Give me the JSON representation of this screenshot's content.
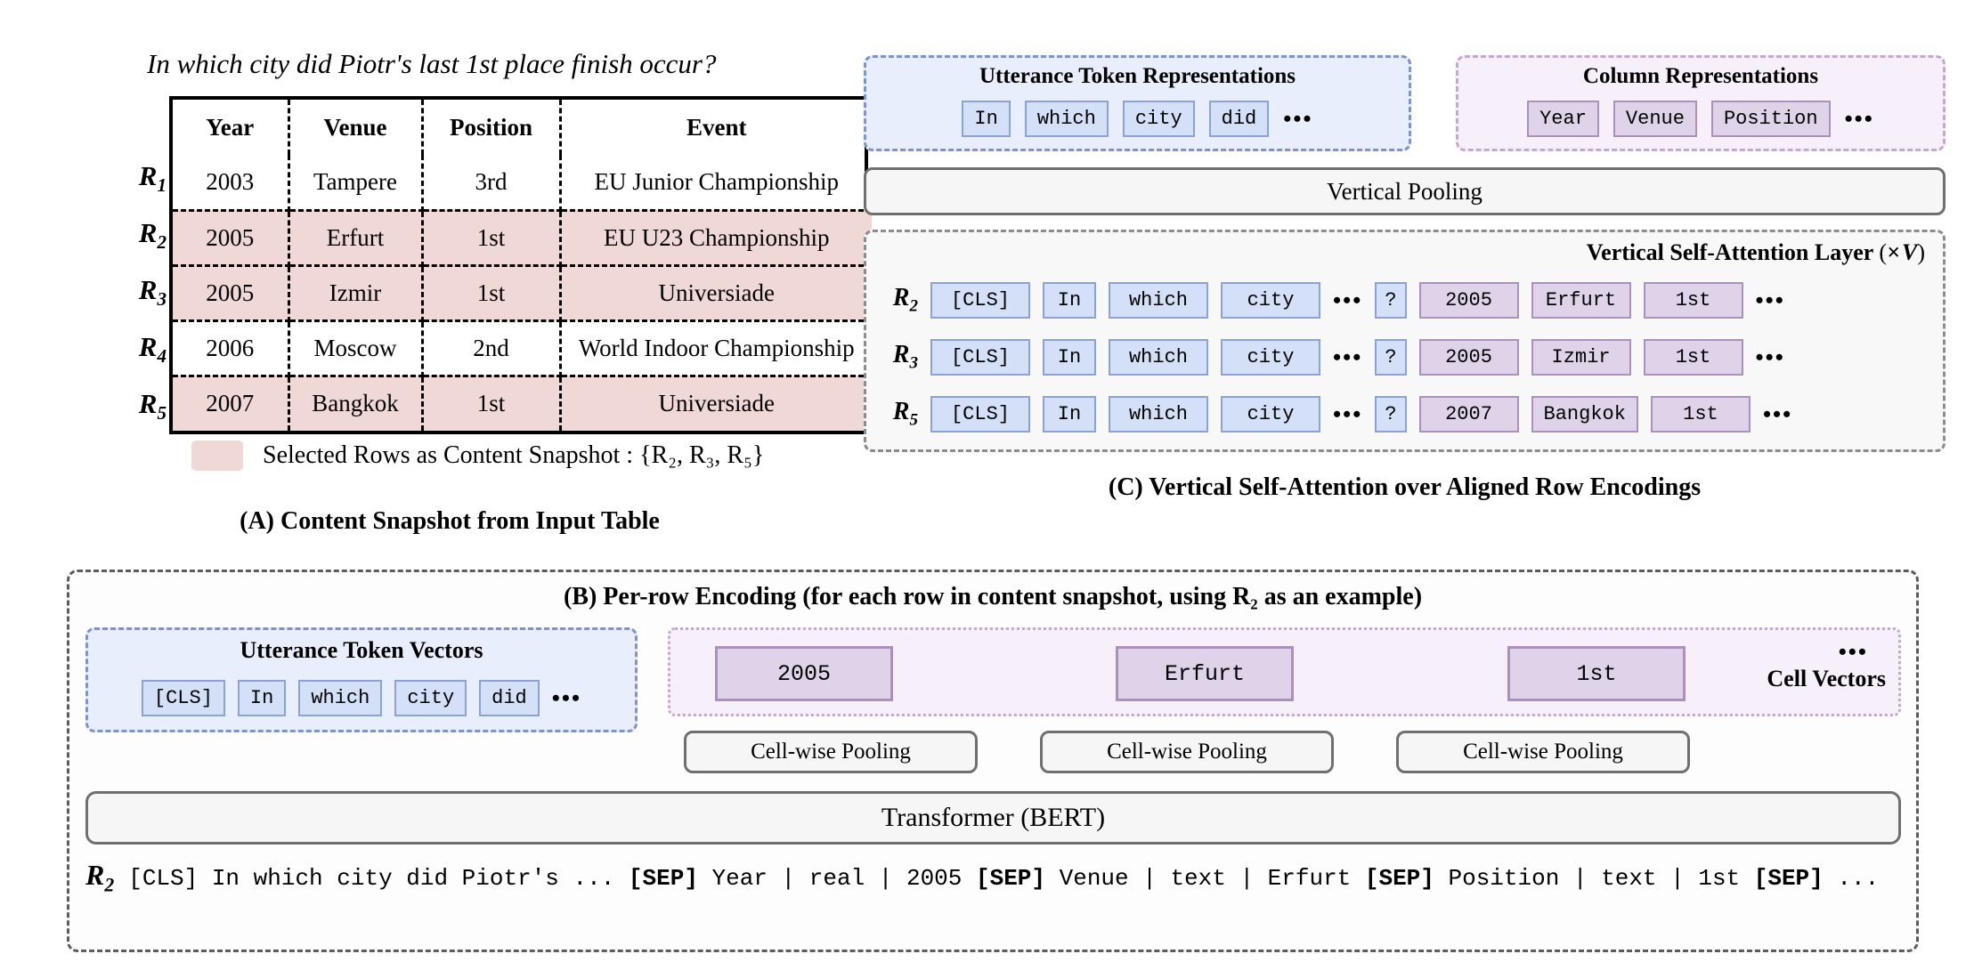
{
  "question": "In which city did Piotr's last 1st place finish occur?",
  "table": {
    "headers": [
      "Year",
      "Venue",
      "Position",
      "Event"
    ],
    "row_labels": [
      "R",
      "R",
      "R",
      "R",
      "R"
    ],
    "row_label_subs": [
      "1",
      "2",
      "3",
      "4",
      "5"
    ],
    "rows": [
      {
        "label_sub": "1",
        "selected": false,
        "cells": [
          "2003",
          "Tampere",
          "3rd",
          "EU Junior Championship"
        ]
      },
      {
        "label_sub": "2",
        "selected": true,
        "cells": [
          "2005",
          "Erfurt",
          "1st",
          "EU U23 Championship"
        ]
      },
      {
        "label_sub": "3",
        "selected": true,
        "cells": [
          "2005",
          "Izmir",
          "1st",
          "Universiade"
        ]
      },
      {
        "label_sub": "4",
        "selected": false,
        "cells": [
          "2006",
          "Moscow",
          "2nd",
          "World Indoor Championship"
        ]
      },
      {
        "label_sub": "5",
        "selected": true,
        "cells": [
          "2007",
          "Bangkok",
          "1st",
          "Universiade"
        ]
      }
    ]
  },
  "legend": {
    "text": "Selected Rows as Content Snapshot : {R₂, R₃, R₅}",
    "swatch_color": "#f0d8d6"
  },
  "captions": {
    "a": "(A) Content Snapshot from Input Table",
    "b": "(B) Per-row Encoding (for each row in content snapshot, using R₂ as an example)",
    "c": "(C) Vertical Self-Attention over Aligned Row Encodings"
  },
  "panel_c": {
    "utterance_box": {
      "title": "Utterance Token Representations",
      "tokens": [
        "In",
        "which",
        "city",
        "did"
      ],
      "ellipsis": "•••"
    },
    "column_box": {
      "title": "Column Representations",
      "tokens": [
        "Year",
        "Venue",
        "Position"
      ],
      "ellipsis": "•••"
    },
    "vertical_pooling_label": "Vertical Pooling",
    "vsa_title": "Vertical Self-Attention Layer",
    "vsa_multiplier": "(× V)",
    "rows": [
      {
        "label_sub": "2",
        "utterance_tokens": [
          "[CLS]",
          "In",
          "which",
          "city"
        ],
        "mid_ellipsis": "•••",
        "question_token": "?",
        "cell_tokens": [
          "2005",
          "Erfurt",
          "1st"
        ],
        "end_ellipsis": "•••"
      },
      {
        "label_sub": "3",
        "utterance_tokens": [
          "[CLS]",
          "In",
          "which",
          "city"
        ],
        "mid_ellipsis": "•••",
        "question_token": "?",
        "cell_tokens": [
          "2005",
          "Izmir",
          "1st"
        ],
        "end_ellipsis": "•••"
      },
      {
        "label_sub": "5",
        "utterance_tokens": [
          "[CLS]",
          "In",
          "which",
          "city"
        ],
        "mid_ellipsis": "•••",
        "question_token": "?",
        "cell_tokens": [
          "2007",
          "Bangkok",
          "1st"
        ],
        "end_ellipsis": "•••"
      }
    ]
  },
  "panel_b": {
    "utterance_box": {
      "title": "Utterance Token Vectors",
      "tokens": [
        "[CLS]",
        "In",
        "which",
        "city",
        "did"
      ],
      "ellipsis": "•••"
    },
    "cell_vectors": {
      "label": "Cell Vectors",
      "ellipsis": "•••",
      "cells": [
        "2005",
        "Erfurt",
        "1st"
      ]
    },
    "pooling_labels": [
      "Cell-wise Pooling",
      "Cell-wise Pooling",
      "Cell-wise Pooling"
    ],
    "transformer_label": "Transformer (BERT)",
    "sequence_row_label_sub": "2",
    "sequence_parts": [
      {
        "text": "[CLS] In which city did Piotr's ... ",
        "bold": false
      },
      {
        "text": "[SEP]",
        "bold": true
      },
      {
        "text": " Year | real | 2005 ",
        "bold": false
      },
      {
        "text": "[SEP]",
        "bold": true
      },
      {
        "text": " Venue | text | Erfurt ",
        "bold": false
      },
      {
        "text": "[SEP]",
        "bold": true
      },
      {
        "text": " Position | text | 1st ",
        "bold": false
      },
      {
        "text": "[SEP]",
        "bold": true
      },
      {
        "text": " ...",
        "bold": false
      }
    ]
  },
  "colors": {
    "selected_row": "#f0d8d6",
    "utterance_fill": "#e8eefb",
    "utterance_token": "#d3e0f7",
    "utterance_border": "#8ba3d4",
    "column_fill": "#f7effa",
    "cell_token": "#ded3e8",
    "cell_border": "#ab90bd",
    "pool_fill": "#f6f6f6"
  }
}
